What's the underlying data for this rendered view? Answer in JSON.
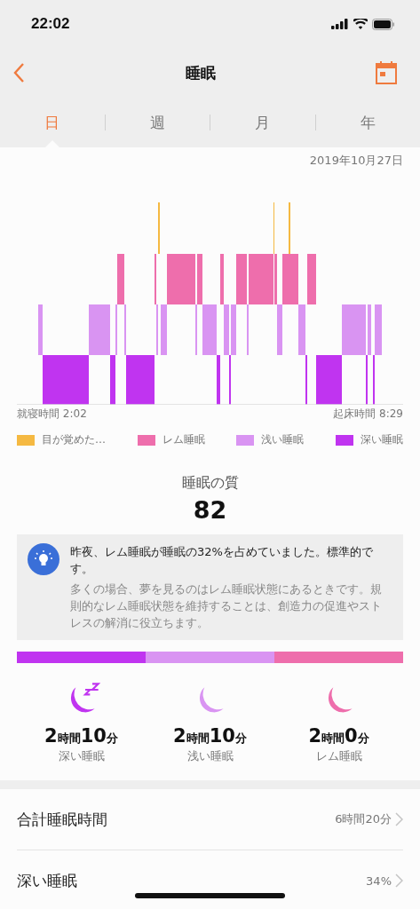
{
  "status_bar": {
    "time": "22:02"
  },
  "nav": {
    "title": "睡眠"
  },
  "tabs": [
    {
      "label": "日",
      "selected": true
    },
    {
      "label": "週",
      "selected": false
    },
    {
      "label": "月",
      "selected": false
    },
    {
      "label": "年",
      "selected": false
    }
  ],
  "date": "2019年10月27日",
  "hypnogram": {
    "start": "就寝時間 2:02",
    "end": "起床時間 8:29"
  },
  "legend": [
    {
      "label": "目が覚めた…",
      "color": "#f5b942"
    },
    {
      "label": "レム睡眠",
      "color": "#ee6eac"
    },
    {
      "label": "浅い睡眠",
      "color": "#d994f2"
    },
    {
      "label": "深い睡眠",
      "color": "#c034f0"
    }
  ],
  "quality": {
    "label": "睡眠の質",
    "score": "82"
  },
  "tip": {
    "title": "昨夜、レム睡眠が睡眠の32%を占めていました。標準的です。",
    "body": "多くの場合、夢を見るのはレム睡眠状態にあるときです。規則的なレム睡眠状態を維持することは、創造力の促進やストレスの解消に役立ちます。"
  },
  "stages": [
    {
      "kind": "deep",
      "label": "深い睡眠",
      "duration": "2時間10分",
      "color": "#c034f0"
    },
    {
      "kind": "light",
      "label": "浅い睡眠",
      "duration": "2時間10分",
      "color": "#d994f2"
    },
    {
      "kind": "rem",
      "label": "レム睡眠",
      "duration": "2時間0分",
      "color": "#ee6eac"
    }
  ],
  "rows": [
    {
      "label": "合計睡眠時間",
      "value": "6時間20分"
    },
    {
      "label": "深い睡眠",
      "value": "34%"
    }
  ]
}
